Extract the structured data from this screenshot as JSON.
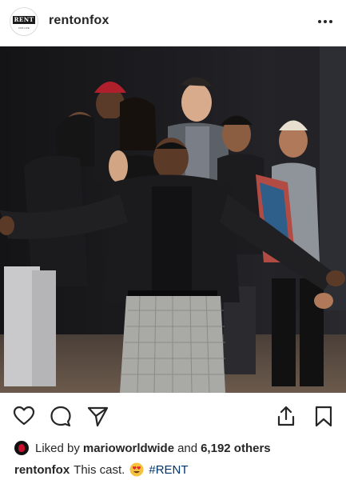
{
  "header": {
    "avatar_logo_text": "RENT",
    "avatar_logo_sub": "FOX LIVE",
    "username": "rentonfox"
  },
  "post": {
    "image_alt": "Cast group photo",
    "actions": [
      "heart-icon",
      "comment-icon",
      "share-icon",
      "upload-icon",
      "bookmark-icon"
    ]
  },
  "likes": {
    "prefix": "Liked by",
    "user": "marioworldwide",
    "connector": "and",
    "others": "6,192 others"
  },
  "caption": {
    "username": "rentonfox",
    "text": "This cast.",
    "emoji": "heart-eyes-emoji",
    "hashtag": "#RENT"
  },
  "colors": {
    "text": "#262626",
    "hashtag": "#003569",
    "border": "#dbdbdb"
  }
}
